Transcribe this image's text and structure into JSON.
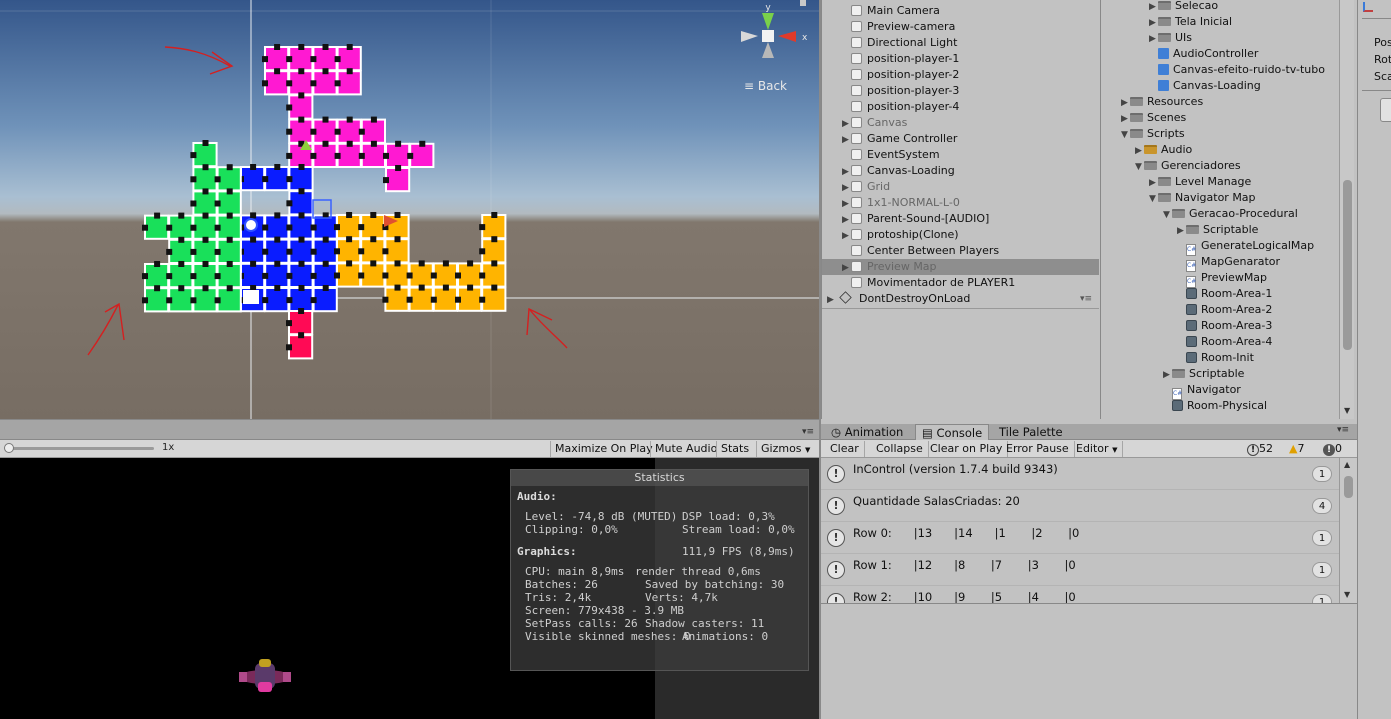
{
  "scene": {
    "back_label": "Back",
    "colors": {
      "magenta": "#ff19d2",
      "green": "#19e05a",
      "blue": "#0a1cff",
      "orange": "#ffb400",
      "red": "#ff0a55",
      "annotation": "#d42020"
    }
  },
  "game": {
    "zoom_label": "1x",
    "toolbar": {
      "maximize": "Maximize On Play",
      "mute": "Mute Audio",
      "stats": "Stats",
      "gizmos": "Gizmos"
    }
  },
  "statistics": {
    "title": "Statistics",
    "audio_heading": "Audio:",
    "audio_lines": [
      {
        "left": "Level: -74,8 dB (MUTED)",
        "right": "DSP load: 0,3%"
      },
      {
        "left": "Clipping: 0,0%",
        "right": "Stream load: 0,0%"
      }
    ],
    "graphics_heading": "Graphics:",
    "fps": "111,9 FPS (8,9ms)",
    "graphics_lines": [
      {
        "left": "CPU: main 8,9ms",
        "right": "render thread 0,6ms"
      },
      {
        "left": "Batches: 26",
        "right": "Saved by batching: 30"
      },
      {
        "left": "Tris: 2,4k",
        "right": "Verts: 4,7k"
      },
      {
        "left": "Screen: 779x438 - 3.9 MB",
        "right": ""
      },
      {
        "left": "SetPass calls: 26",
        "right": "Shadow casters: 11"
      },
      {
        "left": "Visible skinned meshes: 0",
        "right": "Animations: 0"
      }
    ]
  },
  "hierarchy": {
    "items": [
      {
        "label": "Main Camera",
        "fold": false,
        "dim": false,
        "selected": false
      },
      {
        "label": "Preview-camera",
        "fold": false,
        "dim": false,
        "selected": false
      },
      {
        "label": "Directional Light",
        "fold": false,
        "dim": false,
        "selected": false
      },
      {
        "label": "position-player-1",
        "fold": false,
        "dim": false,
        "selected": false
      },
      {
        "label": "position-player-2",
        "fold": false,
        "dim": false,
        "selected": false
      },
      {
        "label": "position-player-3",
        "fold": false,
        "dim": false,
        "selected": false
      },
      {
        "label": "position-player-4",
        "fold": false,
        "dim": false,
        "selected": false
      },
      {
        "label": "Canvas",
        "fold": true,
        "dim": true,
        "selected": false
      },
      {
        "label": "Game Controller",
        "fold": true,
        "dim": false,
        "selected": false
      },
      {
        "label": "EventSystem",
        "fold": false,
        "dim": false,
        "selected": false
      },
      {
        "label": "Canvas-Loading",
        "fold": true,
        "dim": false,
        "selected": false
      },
      {
        "label": "Grid",
        "fold": true,
        "dim": true,
        "selected": false
      },
      {
        "label": "1x1-NORMAL-L-0",
        "fold": true,
        "dim": true,
        "selected": false
      },
      {
        "label": "Parent-Sound-[AUDIO]",
        "fold": true,
        "dim": false,
        "selected": false
      },
      {
        "label": "protoship(Clone)",
        "fold": true,
        "dim": false,
        "selected": false
      },
      {
        "label": "Center Between Players",
        "fold": false,
        "dim": false,
        "selected": false
      },
      {
        "label": "Preview Map",
        "fold": true,
        "dim": true,
        "selected": true
      },
      {
        "label": "Movimentador de PLAYER1",
        "fold": false,
        "dim": false,
        "selected": false
      }
    ],
    "scene_root": "DontDestroyOnLoad"
  },
  "project": {
    "items": [
      {
        "label": "Selecao",
        "indent": 2,
        "icon": "folder",
        "fold": "right"
      },
      {
        "label": "Tela Inicial",
        "indent": 2,
        "icon": "folder",
        "fold": "right"
      },
      {
        "label": "UIs",
        "indent": 2,
        "icon": "folder",
        "fold": "right"
      },
      {
        "label": "AudioController",
        "indent": 2,
        "icon": "prefab",
        "fold": "none"
      },
      {
        "label": "Canvas-efeito-ruido-tv-tubo",
        "indent": 2,
        "icon": "prefab",
        "fold": "none"
      },
      {
        "label": "Canvas-Loading",
        "indent": 2,
        "icon": "prefab",
        "fold": "none"
      },
      {
        "label": "Resources",
        "indent": 0,
        "icon": "folder",
        "fold": "right"
      },
      {
        "label": "Scenes",
        "indent": 0,
        "icon": "folder",
        "fold": "right"
      },
      {
        "label": "Scripts",
        "indent": 0,
        "icon": "folder",
        "fold": "down"
      },
      {
        "label": "Audio",
        "indent": 1,
        "icon": "audio",
        "fold": "right"
      },
      {
        "label": "Gerenciadores",
        "indent": 1,
        "icon": "folder",
        "fold": "down"
      },
      {
        "label": "Level Manage",
        "indent": 2,
        "icon": "folder",
        "fold": "right"
      },
      {
        "label": "Navigator Map",
        "indent": 2,
        "icon": "folder",
        "fold": "down"
      },
      {
        "label": "Geracao-Procedural",
        "indent": 3,
        "icon": "folder",
        "fold": "down"
      },
      {
        "label": "Scriptable",
        "indent": 4,
        "icon": "folder",
        "fold": "right"
      },
      {
        "label": "GenerateLogicalMap",
        "indent": 4,
        "icon": "script",
        "fold": "none"
      },
      {
        "label": "MapGenarator",
        "indent": 4,
        "icon": "script",
        "fold": "none"
      },
      {
        "label": "PreviewMap",
        "indent": 4,
        "icon": "script",
        "fold": "none"
      },
      {
        "label": "Room-Area-1",
        "indent": 4,
        "icon": "asset",
        "fold": "none"
      },
      {
        "label": "Room-Area-2",
        "indent": 4,
        "icon": "asset",
        "fold": "none"
      },
      {
        "label": "Room-Area-3",
        "indent": 4,
        "icon": "asset",
        "fold": "none"
      },
      {
        "label": "Room-Area-4",
        "indent": 4,
        "icon": "asset",
        "fold": "none"
      },
      {
        "label": "Room-Init",
        "indent": 4,
        "icon": "asset",
        "fold": "none"
      },
      {
        "label": "Scriptable",
        "indent": 3,
        "icon": "folder",
        "fold": "right"
      },
      {
        "label": "Navigator",
        "indent": 3,
        "icon": "script",
        "fold": "none"
      },
      {
        "label": "Room-Physical",
        "indent": 3,
        "icon": "asset",
        "fold": "none"
      }
    ]
  },
  "inspector": {
    "labels": [
      "Pos",
      "Rot",
      "Sca"
    ]
  },
  "console": {
    "tabs": [
      "Animation",
      "Console",
      "Tile Palette"
    ],
    "active_tab": "Console",
    "toolbar": {
      "clear": "Clear",
      "collapse": "Collapse",
      "clear_on_play": "Clear on Play",
      "error_pause": "Error Pause",
      "editor": "Editor"
    },
    "counts": {
      "logs": "52",
      "warnings": "7",
      "errors": "0"
    },
    "entries": [
      {
        "text": "InControl (version 1.7.4 build 9343)",
        "count": "1"
      },
      {
        "text": "Quantidade SalasCriadas: 20",
        "count": "4"
      },
      {
        "text": "Row 0:      |13      |14      |1       |2       |0",
        "count": "1"
      },
      {
        "text": "Row 1:      |12      |8       |7       |3       |0",
        "count": "1"
      },
      {
        "text": "Row 2:      |10      |9       |5       |4       |0",
        "count": "1"
      }
    ]
  }
}
